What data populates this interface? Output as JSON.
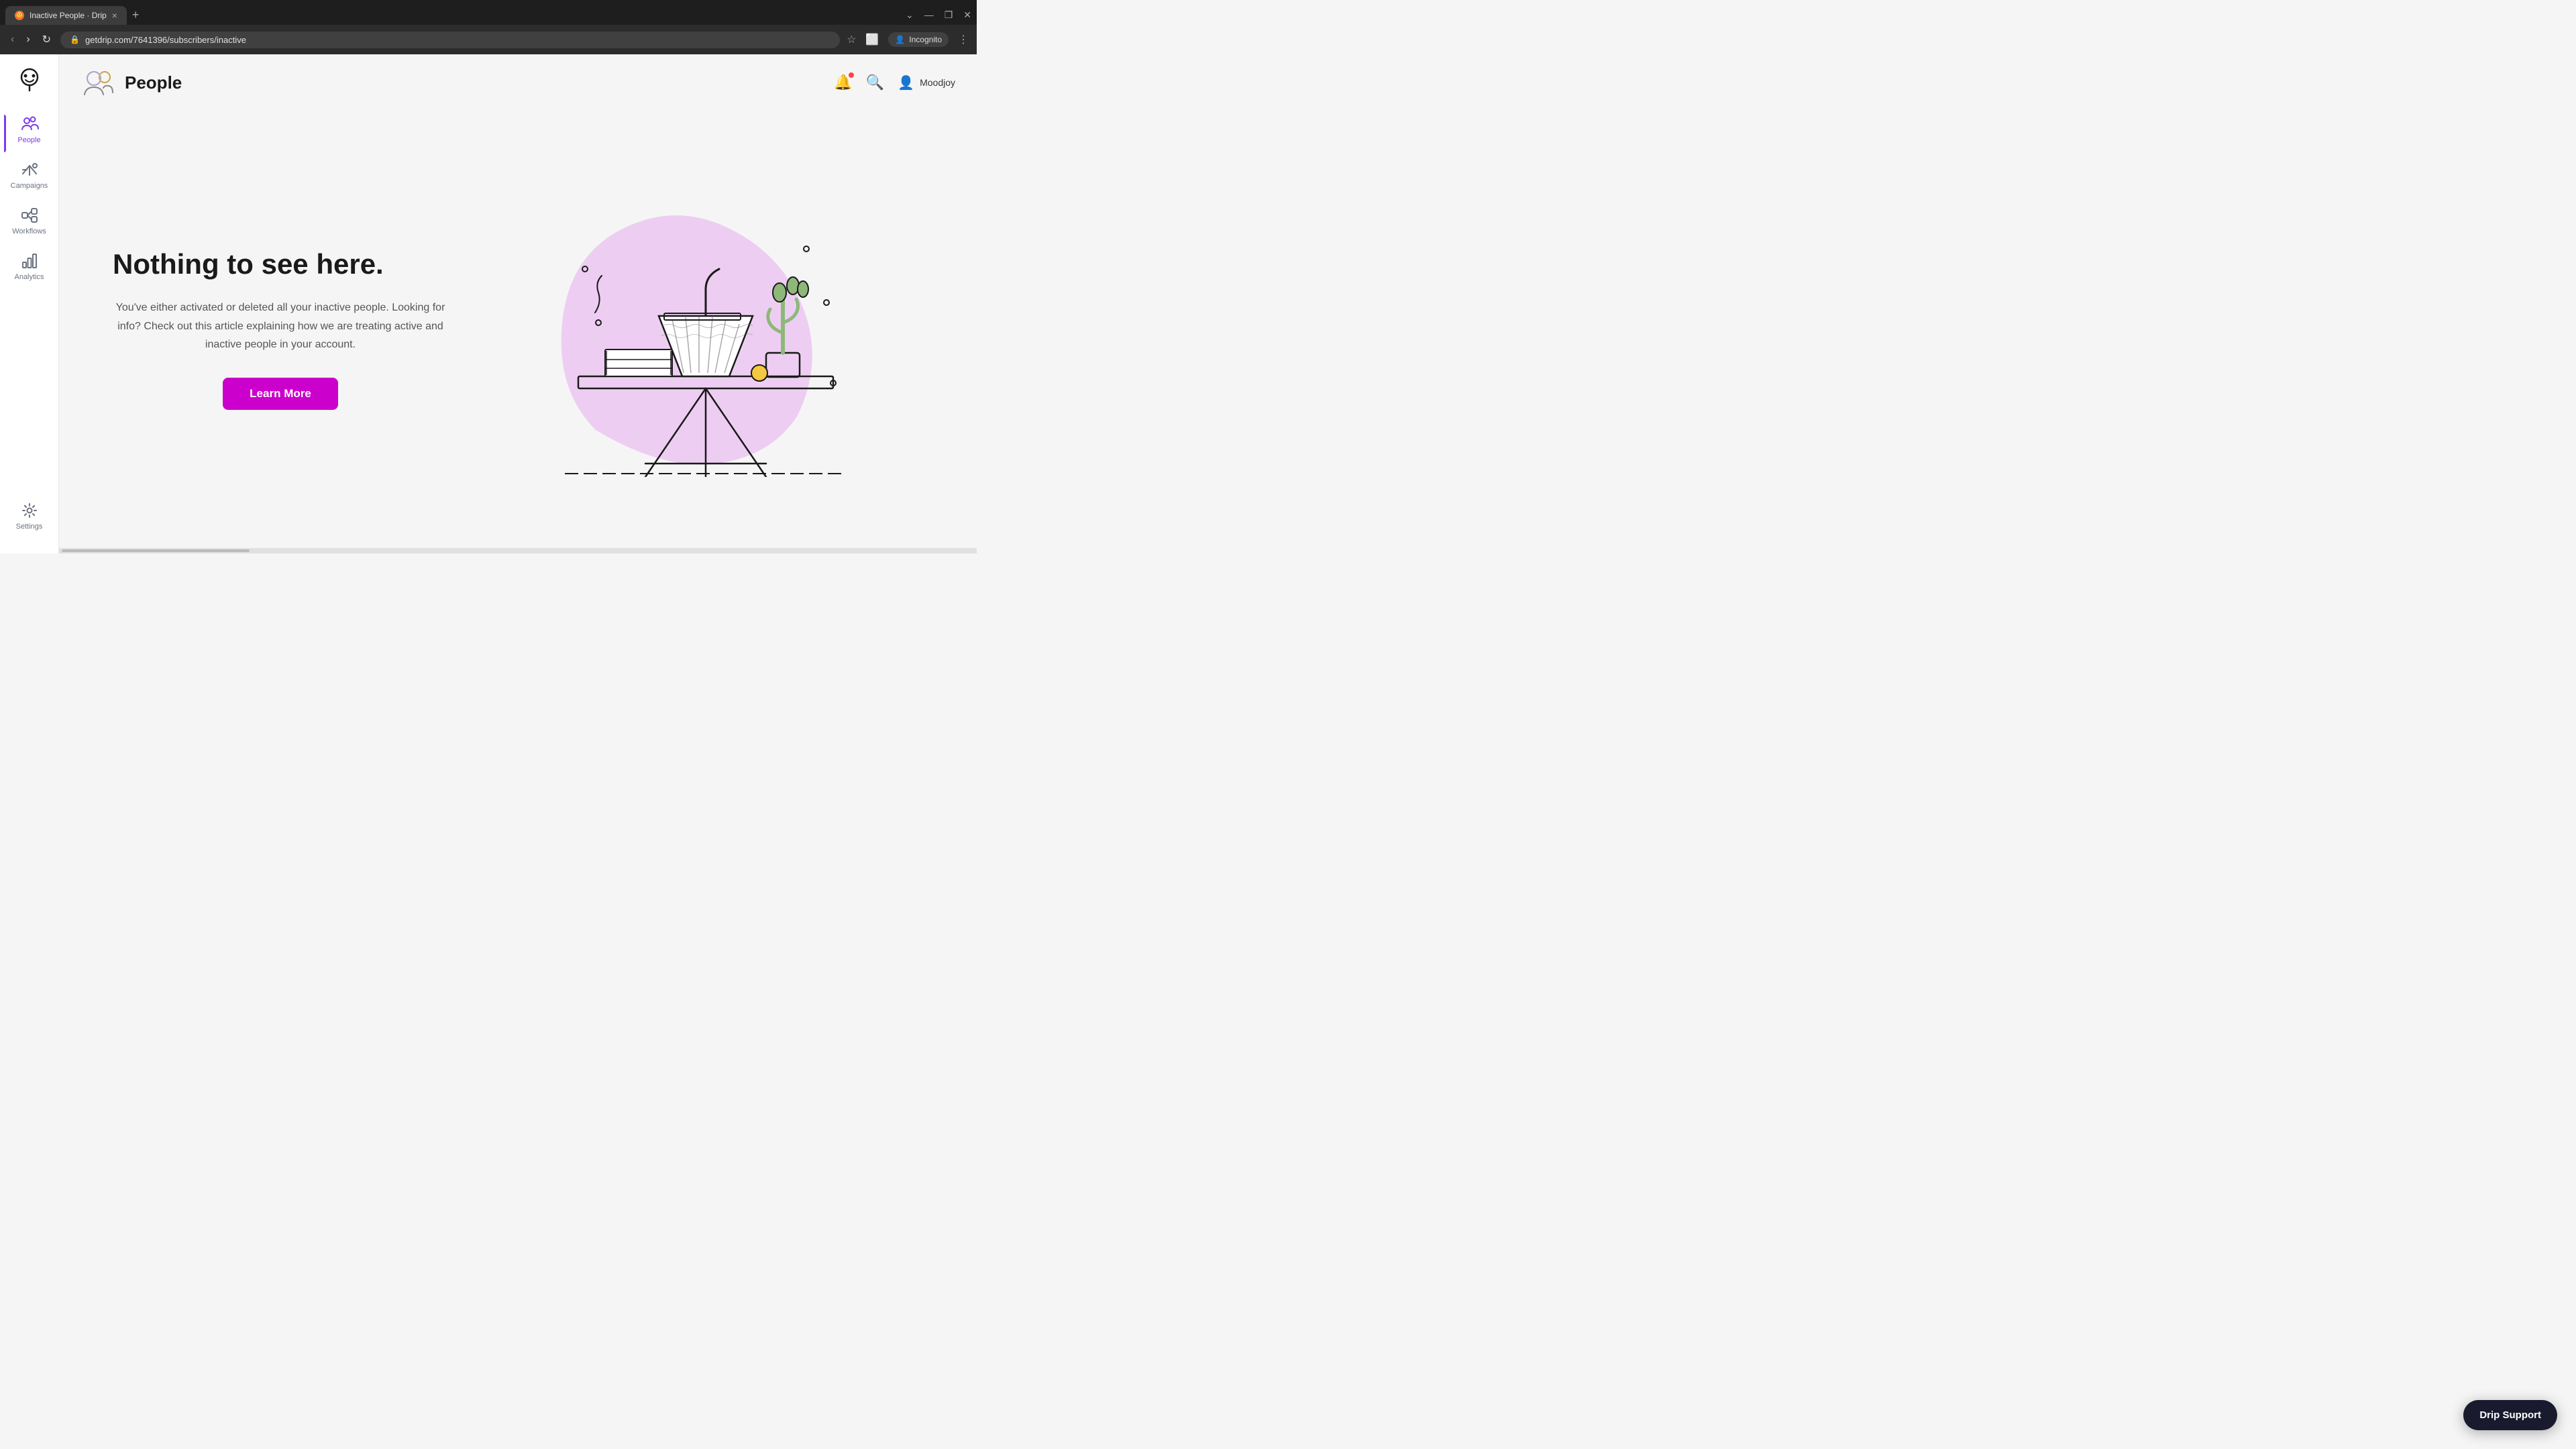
{
  "browser": {
    "tab_title": "Inactive People · Drip",
    "url": "getdrip.com/7641396/subscribers/inactive",
    "tab_close": "×",
    "new_tab": "+",
    "incognito_label": "Incognito",
    "nav": {
      "back": "‹",
      "forward": "›",
      "refresh": "↻"
    },
    "window_controls": {
      "minimize": "—",
      "maximize": "❐",
      "close": "✕"
    }
  },
  "sidebar": {
    "items": [
      {
        "id": "people",
        "label": "People",
        "active": true
      },
      {
        "id": "campaigns",
        "label": "Campaigns",
        "active": false
      },
      {
        "id": "workflows",
        "label": "Workflows",
        "active": false
      },
      {
        "id": "analytics",
        "label": "Analytics",
        "active": false
      },
      {
        "id": "settings",
        "label": "Settings",
        "active": false
      }
    ]
  },
  "header": {
    "page_title": "People"
  },
  "topbar": {
    "user_name": "Moodjoy"
  },
  "content": {
    "empty_title": "Nothing to see here.",
    "empty_description": "You've either activated or deleted all your inactive people. Looking for info? Check out this article explaining how we are treating active and inactive people in your account.",
    "learn_more_label": "Learn More"
  },
  "drip_support": {
    "label": "Drip Support"
  },
  "colors": {
    "accent_purple": "#7c3aed",
    "magenta_btn": "#cc00cc",
    "dark_btn": "#1a1a2e"
  }
}
